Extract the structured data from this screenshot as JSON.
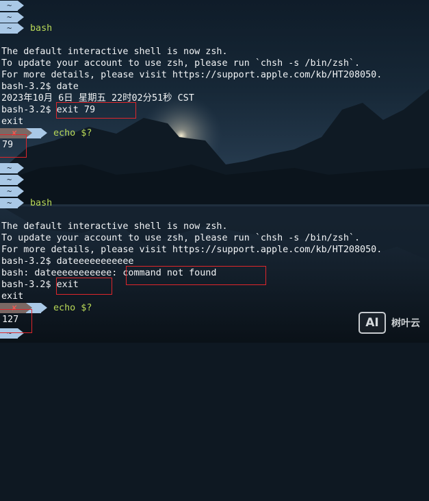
{
  "prompt": {
    "tilde": "~",
    "bash_label": "bash",
    "status_symbol": "✘",
    "echo_cmd": "echo $?"
  },
  "session1": {
    "msg1": "The default interactive shell is now zsh.",
    "msg2": "To update your account to use zsh, please run `chsh -s /bin/zsh`.",
    "msg3": "For more details, please visit https://support.apple.com/kb/HT208050.",
    "date_prompt": "bash-3.2$ date",
    "date_output": "2023年10月 6日 星期五 22时02分51秒 CST",
    "exit_prompt": "bash-3.2$ ",
    "exit_cmd": "exit 79",
    "exit_word": "exit",
    "code": "79"
  },
  "session2": {
    "msg1": "The default interactive shell is now zsh.",
    "msg2": "To update your account to use zsh, please run `chsh -s /bin/zsh`.",
    "msg3": "For more details, please visit https://support.apple.com/kb/HT208050.",
    "cmd_line": "bash-3.2$ dateeeeeeeeeee",
    "err_prefix": "bash: dateeeeeeeeeee: ",
    "err_msg": "command not found",
    "exit_prompt": "bash-3.2$ ",
    "exit_cmd": "exit",
    "exit_word": "exit",
    "code": "127"
  },
  "watermark": {
    "logo": "AI",
    "text": "树叶云"
  },
  "colors": {
    "prompt_segment": "#a9c8e6",
    "status_segment": "#7a6864",
    "status_symbol": "#e35d55",
    "prompt_text": "#b9d957",
    "highlight_box": "#e0262b",
    "terminal_text": "#f2f4f6"
  }
}
